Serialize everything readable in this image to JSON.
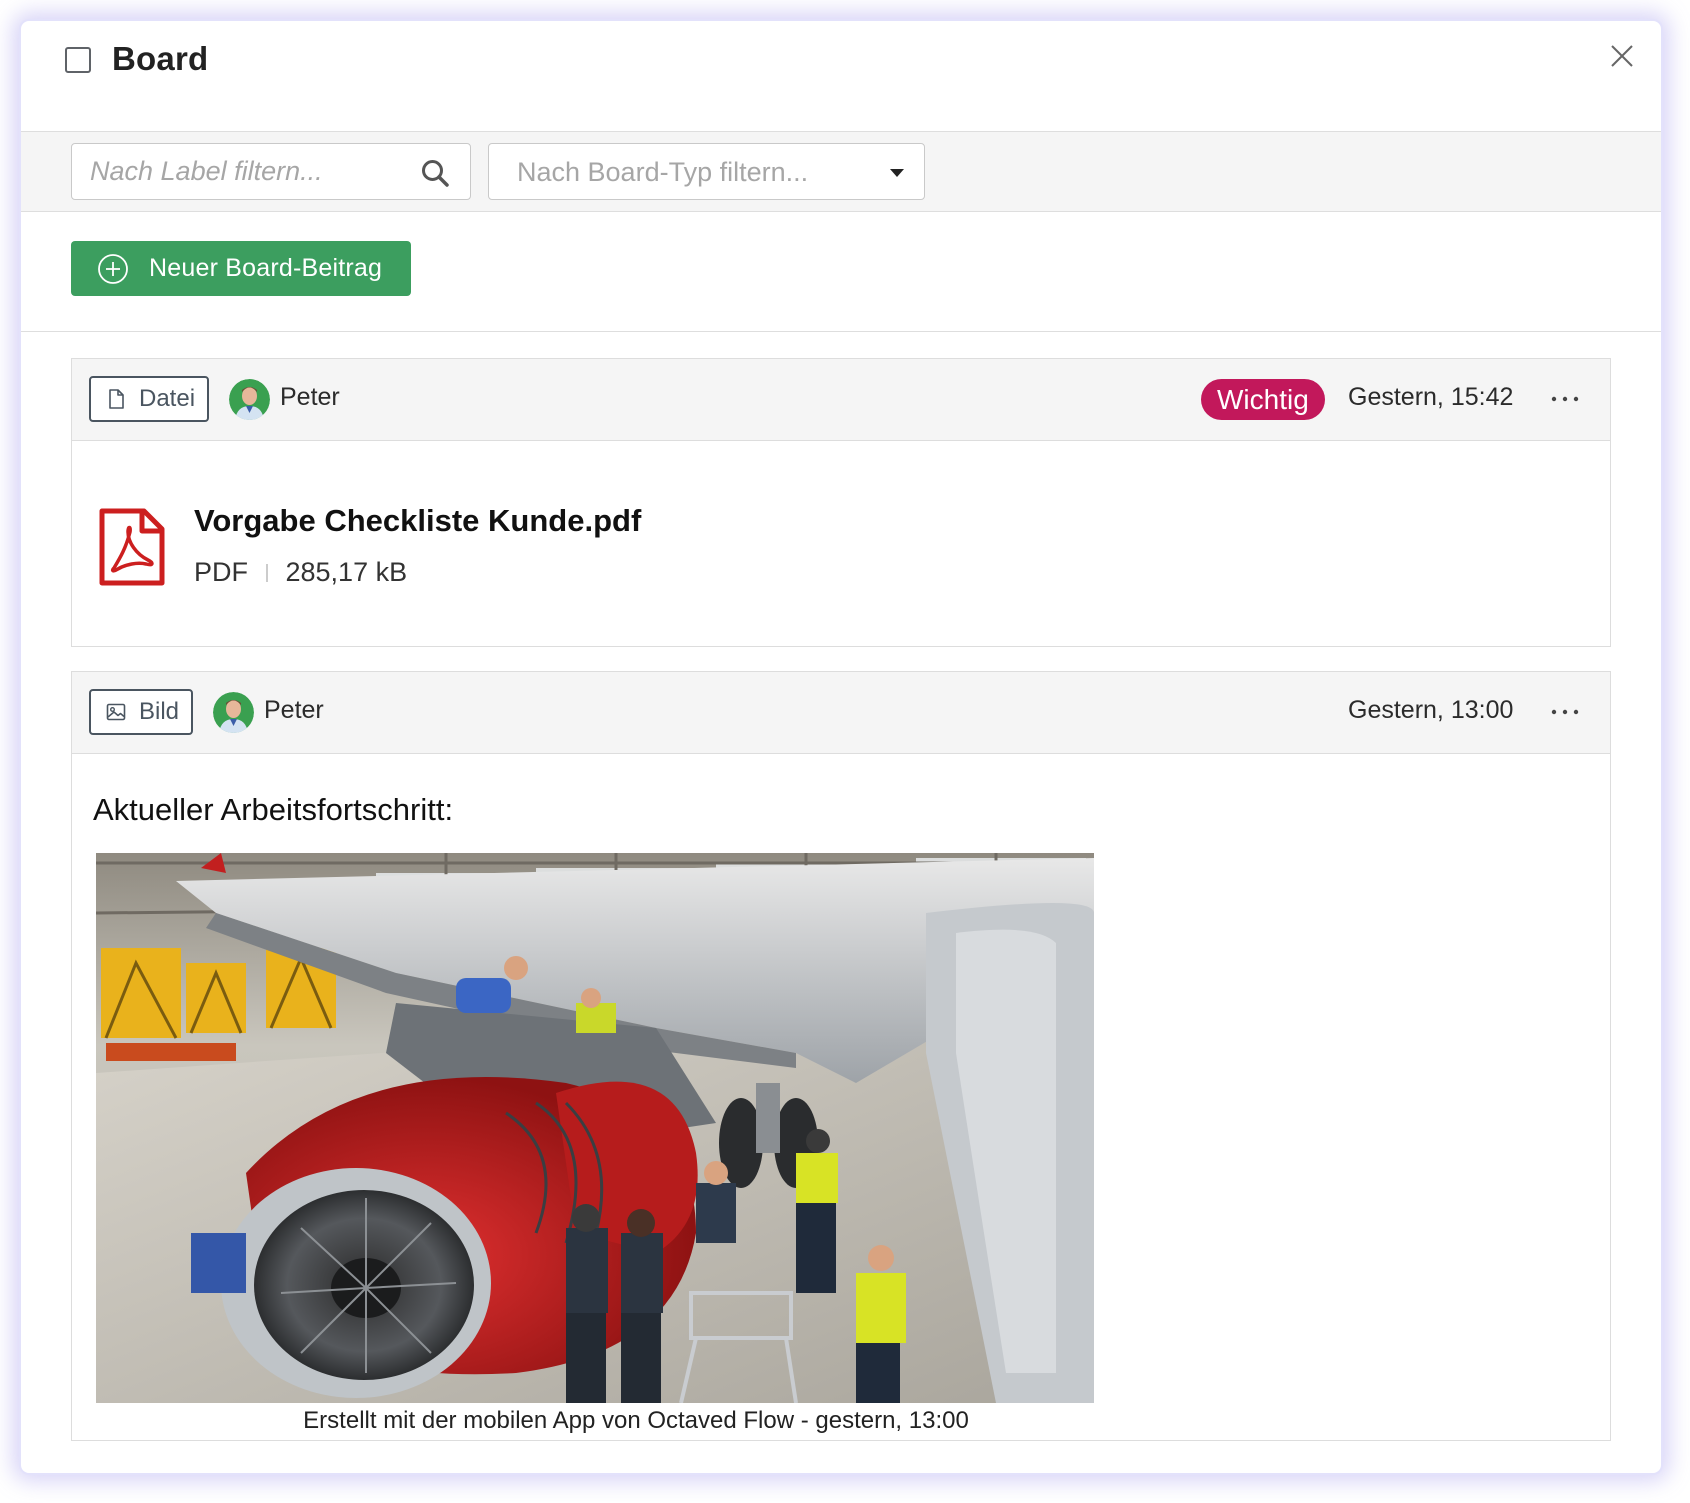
{
  "dialog": {
    "title": "Board"
  },
  "filters": {
    "label_placeholder": "Nach Label filtern...",
    "type_placeholder": "Nach Board-Typ filtern..."
  },
  "actions": {
    "new_post_label": "Neuer Board-Beitrag"
  },
  "posts": [
    {
      "type_label": "Datei",
      "author": "Peter",
      "badge": "Wichtig",
      "timestamp": "Gestern, 15:42",
      "file": {
        "name": "Vorgabe Checkliste Kunde.pdf",
        "format": "PDF",
        "size": "285,17 kB"
      }
    },
    {
      "type_label": "Bild",
      "author": "Peter",
      "timestamp": "Gestern, 13:00",
      "heading": "Aktueller Arbeitsfortschritt:",
      "caption": "Erstellt mit der mobilen App von Octaved Flow - gestern, 13:00"
    }
  ],
  "colors": {
    "primary_green": "#3c9e5f",
    "badge_red": "#c2185b",
    "pdf_red": "#cc1f1f"
  },
  "icons": [
    "checkbox-icon",
    "close-icon",
    "search-icon",
    "chevron-down-icon",
    "plus-circle-icon",
    "file-icon",
    "image-icon",
    "more-icon",
    "pdf-icon"
  ]
}
